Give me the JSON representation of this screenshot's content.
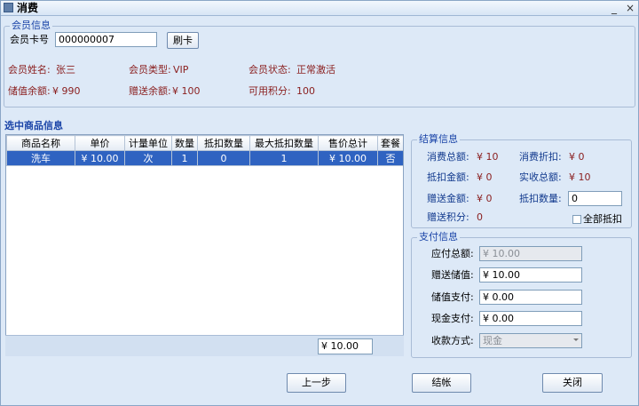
{
  "window": {
    "title": "消费",
    "minimize": "_",
    "close": "×"
  },
  "member": {
    "legend": "会员信息",
    "card_label": "会员卡号",
    "card_value": "000000007",
    "swipe_button": "刷卡",
    "name_label": "会员姓名:",
    "name_value": "张三",
    "type_label": "会员类型:",
    "type_value": "VIP",
    "status_label": "会员状态:",
    "status_value": "正常激活",
    "balance_label": "储值余额:",
    "balance_value": "¥ 990",
    "gift_label": "赠送余额:",
    "gift_value": "¥ 100",
    "points_label": "可用积分:",
    "points_value": "100"
  },
  "products": {
    "title": "选中商品信息",
    "columns": [
      "商品名称",
      "单价",
      "计量单位",
      "数量",
      "抵扣数量",
      "最大抵扣数量",
      "售价总计",
      "套餐"
    ],
    "rows": [
      [
        "洗车",
        "¥ 10.00",
        "次",
        "1",
        "0",
        "1",
        "¥ 10.00",
        "否"
      ]
    ],
    "total": "¥ 10.00"
  },
  "settlement": {
    "legend": "结算信息",
    "total_label": "消费总额:",
    "total_value": "¥ 10",
    "discount_label": "消费折扣:",
    "discount_value": "¥ 0",
    "deduct_label": "抵扣金额:",
    "deduct_value": "¥ 0",
    "received_label": "实收总额:",
    "received_value": "¥ 10",
    "gift_label": "赠送金额:",
    "gift_value": "¥ 0",
    "deduct_qty_label": "抵扣数量:",
    "deduct_qty_value": "0",
    "gift_points_label": "赠送积分:",
    "gift_points_value": "0",
    "all_deduct_label": "全部抵扣"
  },
  "payment": {
    "legend": "支付信息",
    "payable_label": "应付总额:",
    "payable_value": "¥ 10.00",
    "gift_store_label": "赠送储值:",
    "gift_store_value": "¥ 10.00",
    "store_pay_label": "储值支付:",
    "store_pay_value": "¥ 0.00",
    "cash_pay_label": "现金支付:",
    "cash_pay_value": "¥ 0.00",
    "method_label": "收款方式:",
    "method_value": "现金"
  },
  "buttons": {
    "prev": "上一步",
    "checkout": "结帐",
    "close": "关闭"
  }
}
